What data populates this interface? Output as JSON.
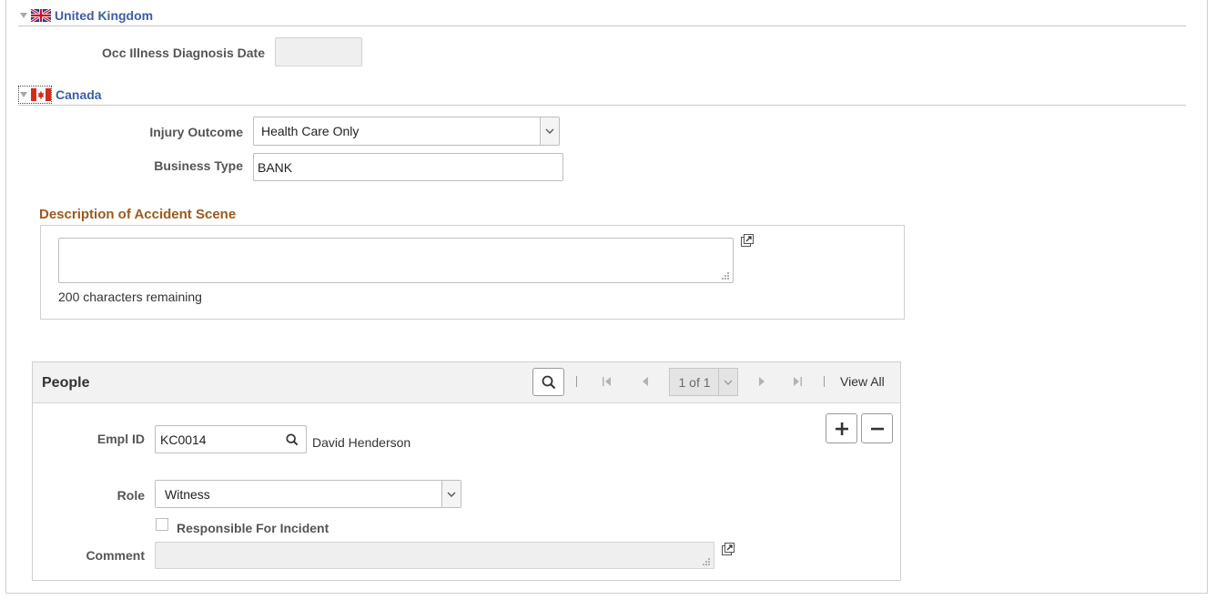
{
  "uk_section": {
    "title": "United Kingdom",
    "occ_illness_label": "Occ Illness Diagnosis Date",
    "occ_illness_value": ""
  },
  "canada_section": {
    "title": "Canada",
    "injury_outcome_label": "Injury Outcome",
    "injury_outcome_value": "Health Care Only",
    "business_type_label": "Business Type",
    "business_type_value": "BANK"
  },
  "accident_scene": {
    "title": "Description of Accident Scene",
    "value": "",
    "chars_remaining": "200 characters remaining"
  },
  "people": {
    "title": "People",
    "pagination": "1 of 1",
    "view_all": "View All",
    "empl_id_label": "Empl ID",
    "empl_id_value": "KC0014",
    "empl_name": "David Henderson",
    "role_label": "Role",
    "role_value": "Witness",
    "responsible_label": "Responsible For Incident",
    "comment_label": "Comment",
    "comment_value": ""
  },
  "icons": {
    "collapse": "triangle-down-icon",
    "uk_flag": "uk-flag-icon",
    "canada_flag": "canada-flag-icon",
    "expand": "expand-icon",
    "search": "search-icon",
    "first": "first-page-icon",
    "prev": "previous-page-icon",
    "next": "next-page-icon",
    "last": "last-page-icon",
    "add": "plus-icon",
    "remove": "minus-icon"
  },
  "colors": {
    "section_title": "#3d5ea5",
    "group_title": "#9c5a1c"
  }
}
